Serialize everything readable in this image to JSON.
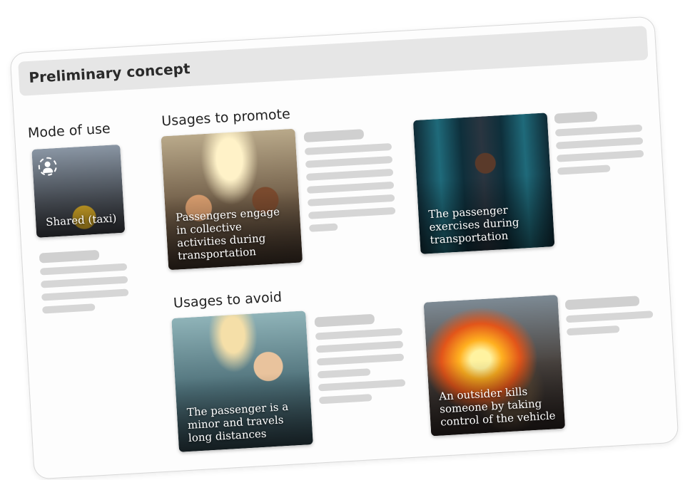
{
  "header": {
    "title": "Preliminary concept"
  },
  "mode_of_use": {
    "title": "Mode of use",
    "card": {
      "label": "Shared (taxi)",
      "icon": "user-dashed-circle-icon"
    }
  },
  "usages_promote": {
    "title": "Usages to promote",
    "cards": [
      {
        "label": "Passengers engage in collective activities during transportation"
      },
      {
        "label": "The passenger exercises during transportation"
      }
    ]
  },
  "usages_avoid": {
    "title": "Usages to avoid",
    "cards": [
      {
        "label": "The passenger is a minor and travels long distances"
      },
      {
        "label": "An outsider kills someone by taking control of the vehicle"
      }
    ]
  },
  "colors": {
    "header_bar": "#e6e6e6",
    "placeholder_text": "#d6d6d6",
    "background": "#ffffff"
  }
}
